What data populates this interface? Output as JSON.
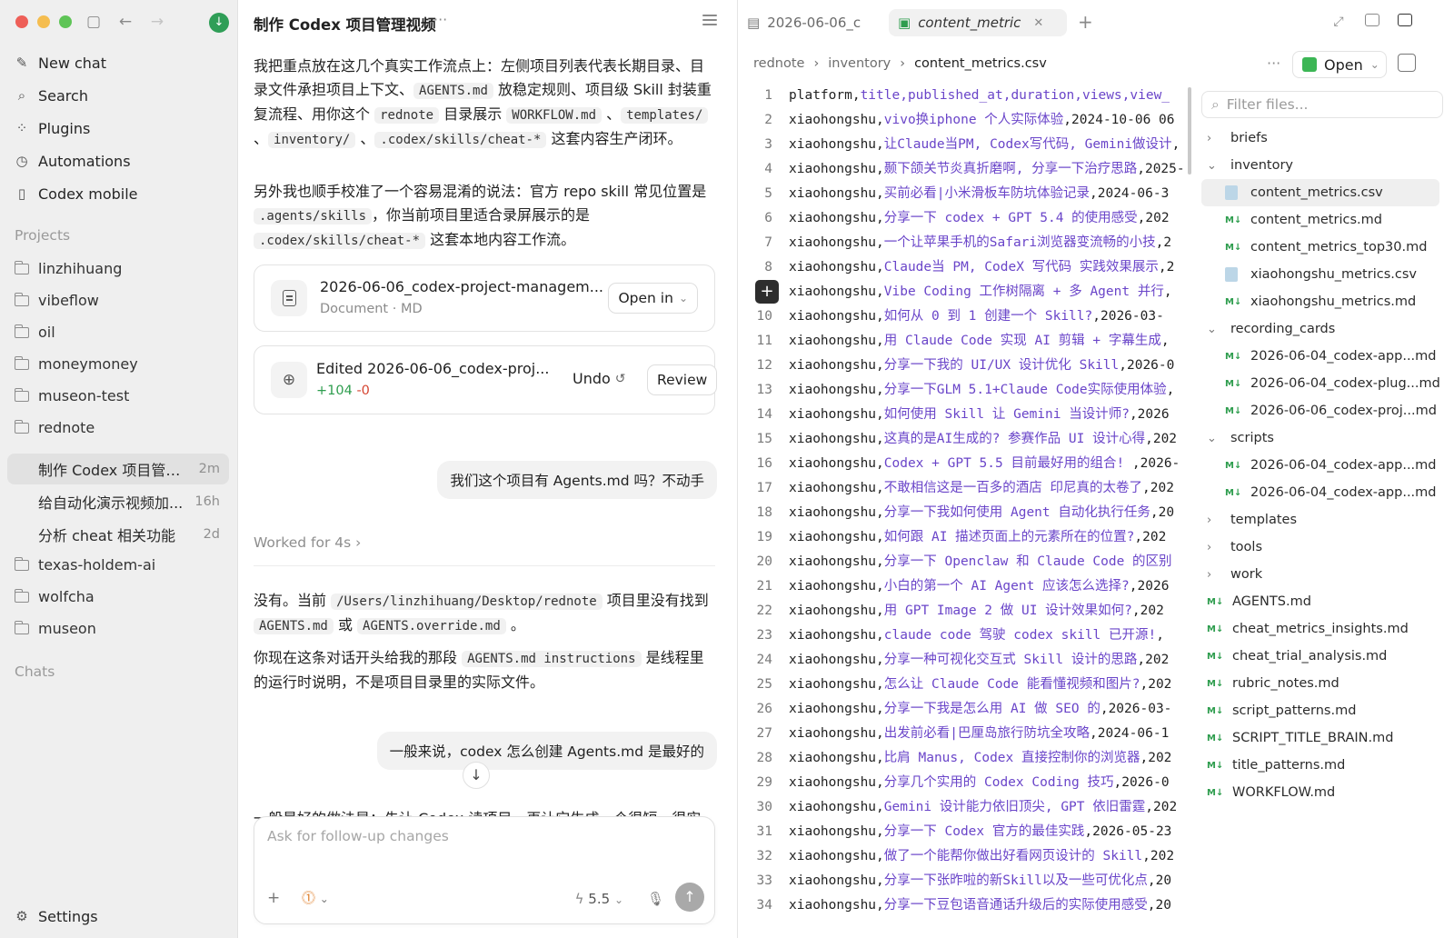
{
  "sidebar": {
    "nav": [
      {
        "label": "New chat",
        "icon": "new-chat-icon"
      },
      {
        "label": "Search",
        "icon": "search-icon"
      },
      {
        "label": "Plugins",
        "icon": "plugins-icon"
      },
      {
        "label": "Automations",
        "icon": "clock-icon"
      },
      {
        "label": "Codex mobile",
        "icon": "phone-icon"
      }
    ],
    "projects_label": "Projects",
    "projects": [
      "linzhihuang",
      "vibeflow",
      "oil",
      "moneymoney",
      "museon-test",
      "rednote"
    ],
    "project_chats": [
      {
        "title": "制作 Codex 项目管理...",
        "age": "2m"
      },
      {
        "title": "给自动化演示视频加...",
        "age": "16h"
      },
      {
        "title": "分析 cheat 相关功能",
        "age": "2d"
      }
    ],
    "more_projects": [
      "texas-holdem-ai",
      "wolfcha",
      "museon"
    ],
    "chats_label": "Chats",
    "settings_label": "Settings"
  },
  "chat": {
    "title": "制作 Codex 项目管理视频",
    "para1": {
      "t1": "我把重点放在这几个真实工作流点上：左侧项目列表代表长期目录、目录文件承担项目上下文、",
      "c1": "AGENTS.md",
      "t2": " 放稳定规则、项目级 Skill 封装重复流程、用你这个 ",
      "c2": "rednote",
      "t3": " 目录展示 ",
      "c3": "WORKFLOW.md",
      "t4": " 、",
      "c4": "templates/",
      "t5": " 、",
      "c5": "inventory/",
      "t6": " 、",
      "c6": ".codex/skills/cheat-*",
      "t7": " 这套内容生产闭环。"
    },
    "para2": {
      "t1": "另外我也顺手校准了一个容易混淆的说法：官方 repo skill 常见位置是 ",
      "c1": ".agents/skills",
      "t2": "，你当前项目里适合录屏展示的是 ",
      "c2": ".codex/skills/cheat-*",
      "t3": " 这套本地内容工作流。"
    },
    "file_card": {
      "name": "2026-06-06_codex-project-managem...",
      "meta": "Document · MD",
      "open_label": "Open in"
    },
    "edit_card": {
      "title": "Edited 2026-06-06_codex-proj...",
      "added": "+104",
      "removed": "-0",
      "undo_label": "Undo",
      "review_label": "Review"
    },
    "user_msg1": "我们这个项目有 Agents.md 吗？不动手",
    "worked_label": "Worked for 4s",
    "reply1": {
      "t1": "没有。当前 ",
      "c1": "/Users/linzhihuang/Desktop/rednote",
      "t2": " 项目里没有找到 ",
      "c2": "AGENTS.md",
      "t3": " 或 ",
      "c3": "AGENTS.override.md",
      "t4": " 。"
    },
    "reply2": {
      "t1": "你现在这条对话开头给我的那段 ",
      "c1": "AGENTS.md instructions",
      "t2": " 是线程里的运行时说明，不是项目目录里的实际文件。"
    },
    "user_msg2": "一般来说，codex 怎么创建 Agents.md 是最好的",
    "cut_text": "一般最好的做法是：先让 Codex 读项目，再让它生成一个很短、很实",
    "composer_placeholder": "Ask for follow-up changes",
    "model_label": "5.5"
  },
  "editor": {
    "tabs": [
      {
        "label": "2026-06-06_c",
        "icon": "document-icon"
      },
      {
        "label": "content_metric",
        "icon": "sheet-icon"
      }
    ],
    "breadcrumb": [
      "rednote",
      "inventory",
      "content_metrics.csv"
    ],
    "open_label": "Open",
    "lines": [
      {
        "n": "1",
        "pre": "platform,",
        "title": "title,published_at,duration,views,view_",
        "post": ""
      },
      {
        "n": "2",
        "pre": "xiaohongshu,",
        "title": "vivo换iphone 个人实际体验",
        "post": ",2024-10-06 06"
      },
      {
        "n": "3",
        "pre": "xiaohongshu,",
        "title": "让Claude当PM, Codex写代码, Gemini做设计",
        "post": ","
      },
      {
        "n": "4",
        "pre": "xiaohongshu,",
        "title": "颞下颌关节炎真折磨啊, 分享一下治疗思路",
        "post": ",2025-"
      },
      {
        "n": "5",
        "pre": "xiaohongshu,",
        "title": "买前必看|小米滑板车防坑体验记录",
        "post": ",2024-06-3"
      },
      {
        "n": "6",
        "pre": "xiaohongshu,",
        "title": "分享一下 codex + GPT 5.4 的使用感受",
        "post": ",202"
      },
      {
        "n": "7",
        "pre": "xiaohongshu,",
        "title": "一个让苹果手机的Safari浏览器变流畅的小技",
        "post": ",2"
      },
      {
        "n": "8",
        "pre": "xiaohongshu,",
        "title": "Claude当 PM, CodeX 写代码 实践效果展示",
        "post": ",2"
      },
      {
        "n": "9",
        "pre": "xiaohongshu,",
        "title": "Vibe Coding 工作树隔离 + 多 Agent 并行",
        "post": ","
      },
      {
        "n": "10",
        "pre": "xiaohongshu,",
        "title": "如何从 0 到 1 创建一个 Skill?",
        "post": ",2026-03-"
      },
      {
        "n": "11",
        "pre": "xiaohongshu,",
        "title": "用 Claude Code 实现 AI 剪辑 + 字幕生成",
        "post": ","
      },
      {
        "n": "12",
        "pre": "xiaohongshu,",
        "title": "分享一下我的 UI/UX 设计优化 Skill",
        "post": ",2026-0"
      },
      {
        "n": "13",
        "pre": "xiaohongshu,",
        "title": "分享一下GLM 5.1+Claude Code实际使用体验",
        "post": ","
      },
      {
        "n": "14",
        "pre": "xiaohongshu,",
        "title": "如何使用 Skill 让 Gemini 当设计师?",
        "post": ",2026"
      },
      {
        "n": "15",
        "pre": "xiaohongshu,",
        "title": "这真的是AI生成的? 参赛作品 UI 设计心得",
        "post": ",202"
      },
      {
        "n": "16",
        "pre": "xiaohongshu,",
        "title": "Codex + GPT 5.5 目前最好用的组合! ",
        "post": ",2026-"
      },
      {
        "n": "17",
        "pre": "xiaohongshu,",
        "title": "不敢相信这是一百多的酒店 印尼真的太卷了",
        "post": ",202"
      },
      {
        "n": "18",
        "pre": "xiaohongshu,",
        "title": "分享一下我如何使用 Agent 自动化执行任务",
        "post": ",20"
      },
      {
        "n": "19",
        "pre": "xiaohongshu,",
        "title": "如何跟 AI 描述页面上的元素所在的位置?",
        "post": ",202"
      },
      {
        "n": "20",
        "pre": "xiaohongshu,",
        "title": "分享一下 Openclaw 和 Claude Code 的区别",
        "post": ""
      },
      {
        "n": "21",
        "pre": "xiaohongshu,",
        "title": "小白的第一个 AI Agent 应该怎么选择?",
        "post": ",2026"
      },
      {
        "n": "22",
        "pre": "xiaohongshu,",
        "title": "用 GPT Image 2 做 UI 设计效果如何?",
        "post": ",202"
      },
      {
        "n": "23",
        "pre": "xiaohongshu,",
        "title": "claude code 驾驶 codex skill 已开源!",
        "post": ","
      },
      {
        "n": "24",
        "pre": "xiaohongshu,",
        "title": "分享一种可视化交互式 Skill 设计的思路",
        "post": ",202"
      },
      {
        "n": "25",
        "pre": "xiaohongshu,",
        "title": "怎么让 Claude Code 能看懂视频和图片?",
        "post": ",202"
      },
      {
        "n": "26",
        "pre": "xiaohongshu,",
        "title": "分享一下我是怎么用 AI 做 SEO 的",
        "post": ",2026-03-"
      },
      {
        "n": "27",
        "pre": "xiaohongshu,",
        "title": "出发前必看|巴厘岛旅行防坑全攻略",
        "post": ",2024-06-1"
      },
      {
        "n": "28",
        "pre": "xiaohongshu,",
        "title": "比肩 Manus, Codex 直接控制你的浏览器",
        "post": ",202"
      },
      {
        "n": "29",
        "pre": "xiaohongshu,",
        "title": "分享几个实用的 Codex Coding 技巧",
        "post": ",2026-0"
      },
      {
        "n": "30",
        "pre": "xiaohongshu,",
        "title": "Gemini 设计能力依旧顶尖, GPT 依旧雷霆",
        "post": ",202"
      },
      {
        "n": "31",
        "pre": "xiaohongshu,",
        "title": "分享一下 Codex 官方的最佳实践",
        "post": ",2026-05-23"
      },
      {
        "n": "32",
        "pre": "xiaohongshu,",
        "title": "做了一个能帮你做出好看网页设计的 Skill",
        "post": ",202"
      },
      {
        "n": "33",
        "pre": "xiaohongshu,",
        "title": "分享一下张昨啦的新Skill以及一些可优化点",
        "post": ",20"
      },
      {
        "n": "34",
        "pre": "xiaohongshu,",
        "title": "分享一下豆包语音通话升级后的实际使用感受",
        "post": ",20"
      }
    ],
    "filter_placeholder": "Filter files...",
    "tree": [
      {
        "type": "folder",
        "label": "briefs",
        "depth": 0,
        "open": false
      },
      {
        "type": "folder",
        "label": "inventory",
        "depth": 0,
        "open": true
      },
      {
        "type": "csv",
        "label": "content_metrics.csv",
        "depth": 1,
        "selected": true
      },
      {
        "type": "md",
        "label": "content_metrics.md",
        "depth": 1
      },
      {
        "type": "md",
        "label": "content_metrics_top30.md",
        "depth": 1
      },
      {
        "type": "csv",
        "label": "xiaohongshu_metrics.csv",
        "depth": 1
      },
      {
        "type": "md",
        "label": "xiaohongshu_metrics.md",
        "depth": 1
      },
      {
        "type": "folder",
        "label": "recording_cards",
        "depth": 0,
        "open": true
      },
      {
        "type": "md",
        "label": "2026-06-04_codex-app...md",
        "depth": 1
      },
      {
        "type": "md",
        "label": "2026-06-04_codex-plug...md",
        "depth": 1
      },
      {
        "type": "md",
        "label": "2026-06-06_codex-proj...md",
        "depth": 1
      },
      {
        "type": "folder",
        "label": "scripts",
        "depth": 0,
        "open": true
      },
      {
        "type": "md",
        "label": "2026-06-04_codex-app...md",
        "depth": 1
      },
      {
        "type": "md",
        "label": "2026-06-04_codex-app...md",
        "depth": 1
      },
      {
        "type": "folder",
        "label": "templates",
        "depth": 0,
        "open": false
      },
      {
        "type": "folder",
        "label": "tools",
        "depth": 0,
        "open": false
      },
      {
        "type": "folder",
        "label": "work",
        "depth": 0,
        "open": false
      },
      {
        "type": "md",
        "label": "AGENTS.md",
        "depth": 0
      },
      {
        "type": "md",
        "label": "cheat_metrics_insights.md",
        "depth": 0
      },
      {
        "type": "md",
        "label": "cheat_trial_analysis.md",
        "depth": 0
      },
      {
        "type": "md",
        "label": "rubric_notes.md",
        "depth": 0
      },
      {
        "type": "md",
        "label": "script_patterns.md",
        "depth": 0
      },
      {
        "type": "md",
        "label": "SCRIPT_TITLE_BRAIN.md",
        "depth": 0
      },
      {
        "type": "md",
        "label": "title_patterns.md",
        "depth": 0
      },
      {
        "type": "md",
        "label": "WORKFLOW.md",
        "depth": 0
      }
    ]
  }
}
